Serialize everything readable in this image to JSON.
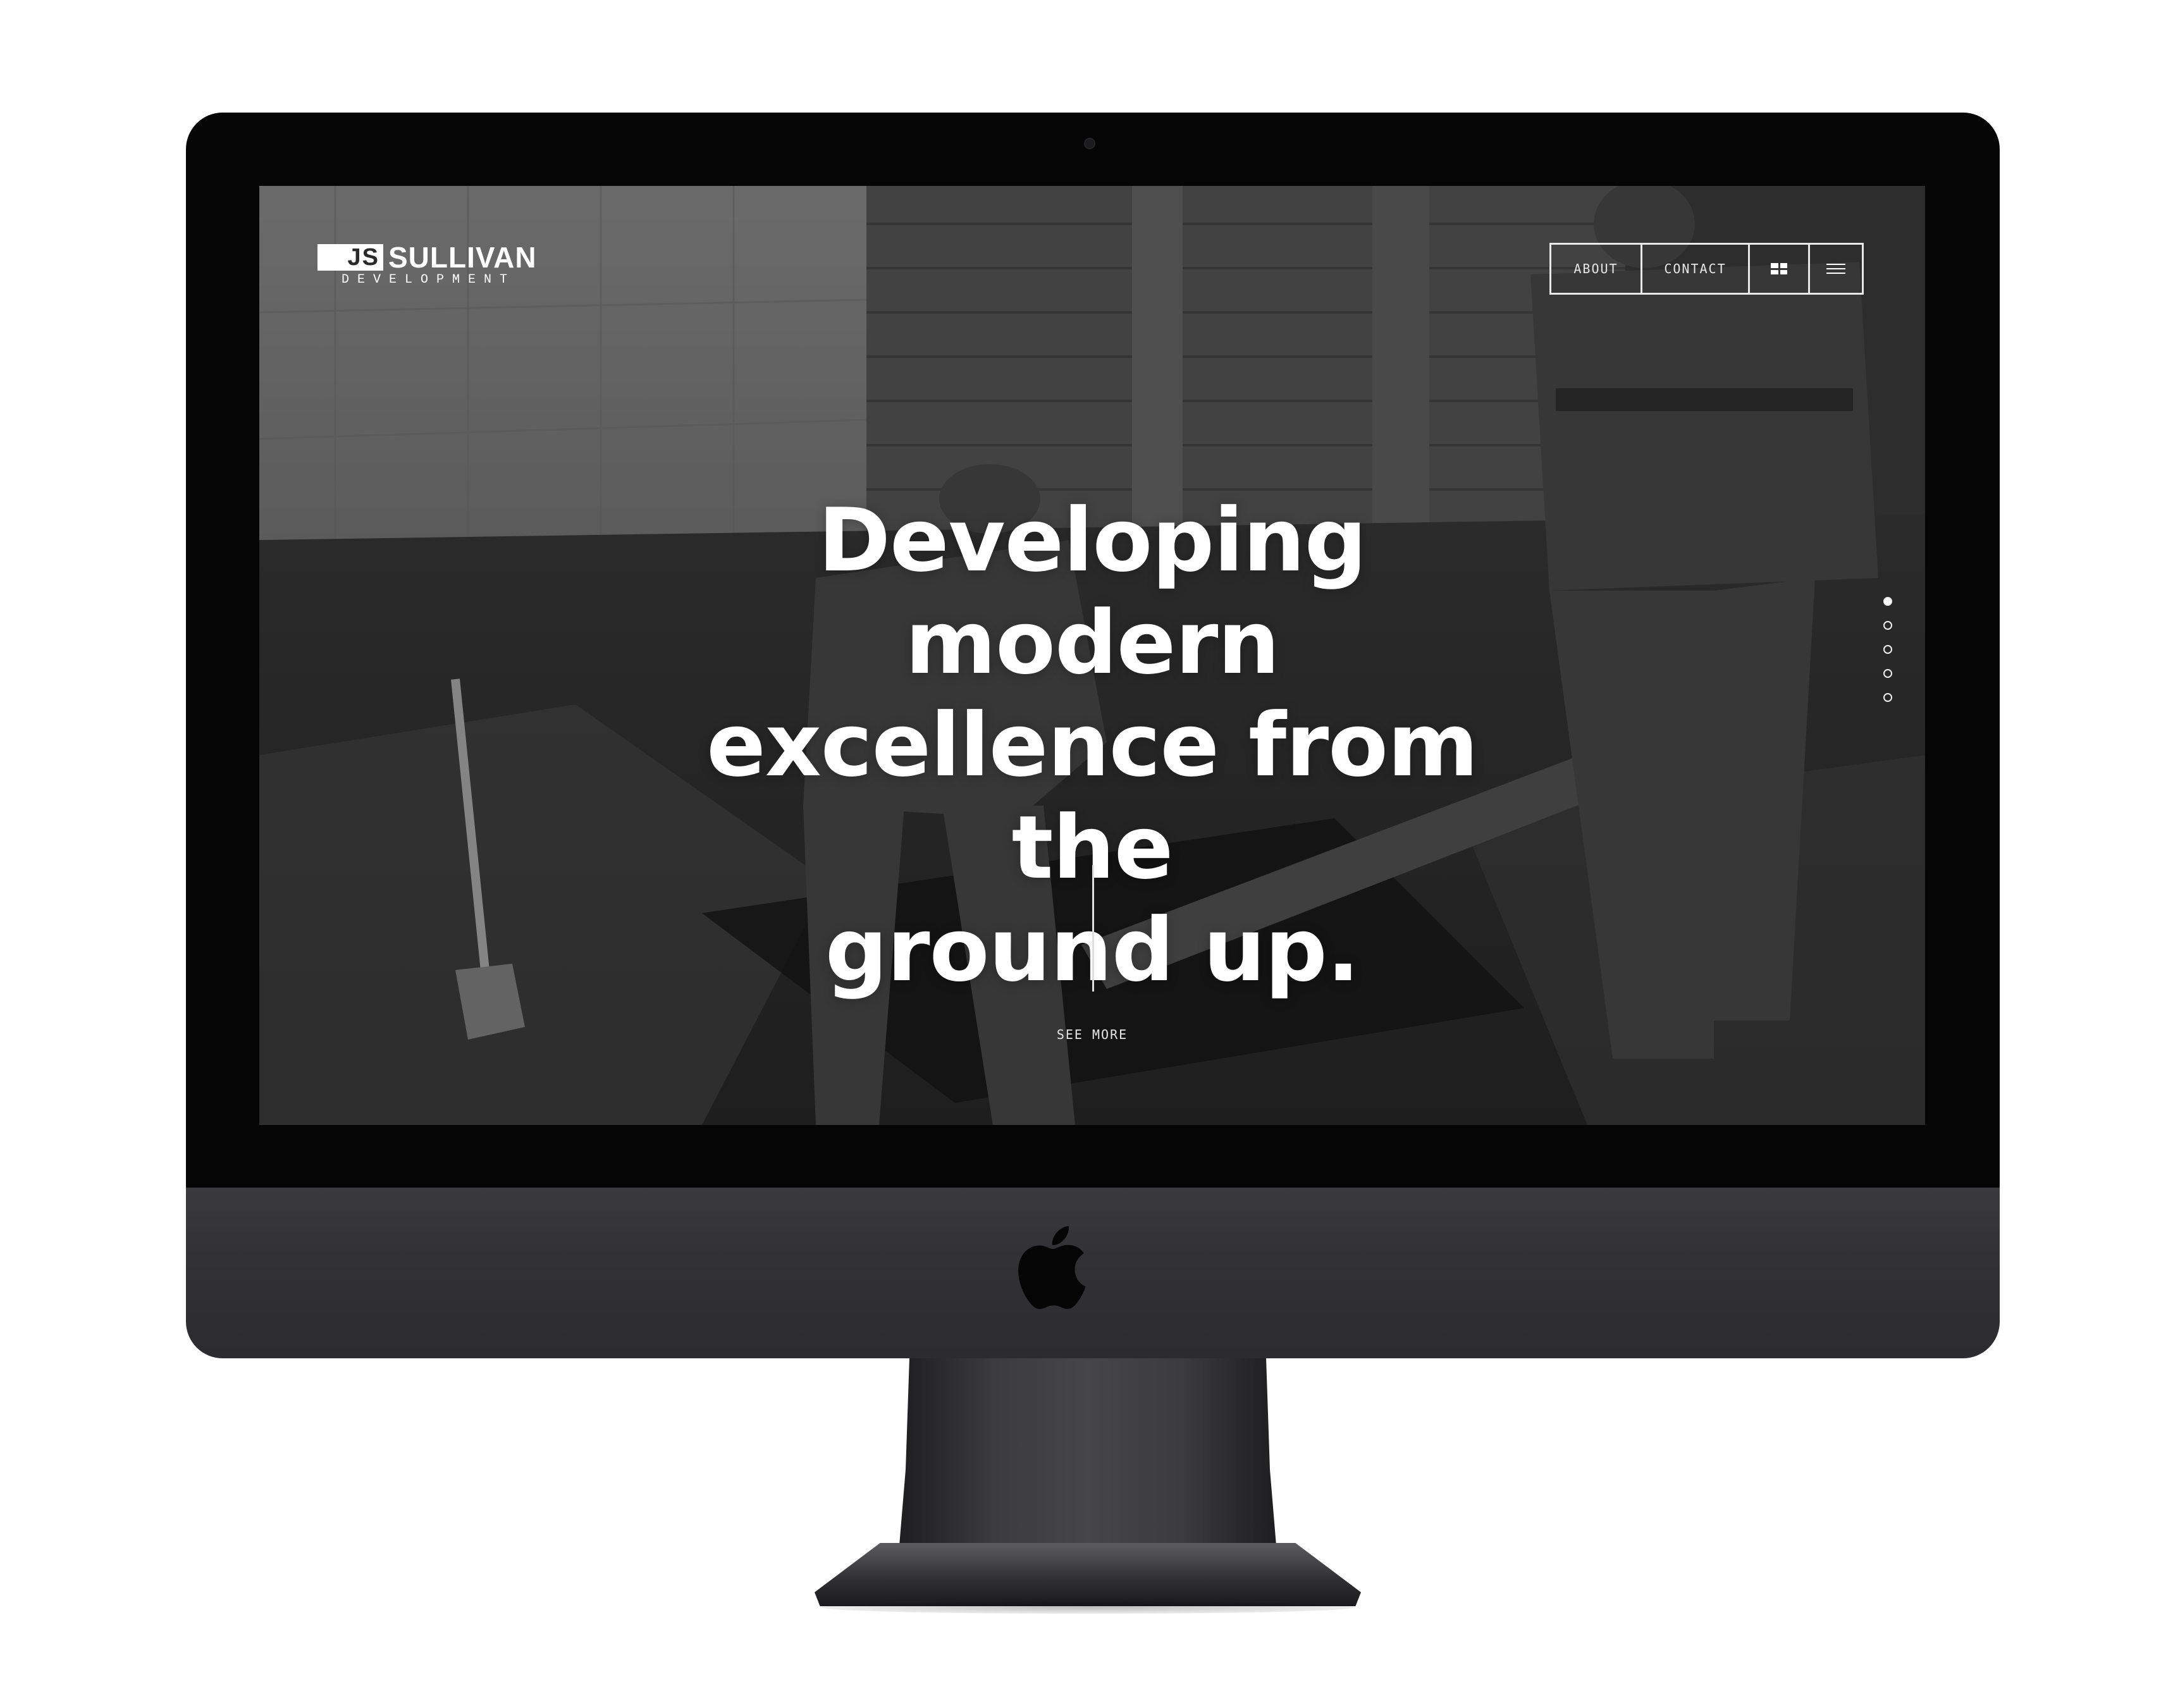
{
  "site": {
    "logo": {
      "mark": "JS",
      "name": "SULLIVAN",
      "tagline": "DEVELOPMENT"
    },
    "nav": {
      "about_label": "ABOUT",
      "contact_label": "CONTACT",
      "grid_icon": "grid-icon",
      "menu_icon": "hamburger-menu-icon"
    },
    "hero": {
      "headline_line1": "Developing modern",
      "headline_line2": "excellence from the",
      "headline_line3": "ground up.",
      "see_more_label": "SEE MORE"
    },
    "slider": {
      "slide_count": 5,
      "active_index": 0
    }
  },
  "colors": {
    "text": "#ffffff",
    "bezel": "#050506",
    "chin": "#323236",
    "photo_tone": "#3a3a3a"
  }
}
